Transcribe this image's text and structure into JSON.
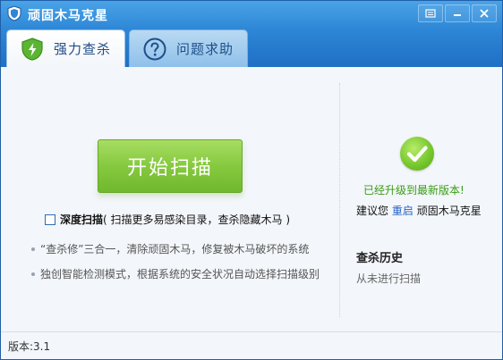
{
  "window": {
    "title": "顽固木马克星",
    "buttons": {
      "menu_icon": "menu-icon",
      "minimize_icon": "minimize-icon",
      "close_icon": "close-icon"
    }
  },
  "tabs": [
    {
      "label": "强力查杀",
      "icon": "shield-lightning-icon",
      "active": true
    },
    {
      "label": "问题求助",
      "icon": "question-icon",
      "active": false
    }
  ],
  "scan": {
    "start_button": "开始扫描",
    "deep_scan_label": "深度扫描",
    "deep_scan_desc": "( 扫描更多易感染目录，查杀隐藏木马 )",
    "deep_scan_checked": false
  },
  "features": [
    "“查杀修”三合一，清除顽固木马，修复被木马破坏的系统",
    "独创智能检测模式，根据系统的安全状况自动选择扫描级别"
  ],
  "status": {
    "upgraded_text": "已经升级到最新版本!",
    "suggest_prefix": "建议您",
    "restart_link": "重启",
    "suggest_suffix": "顽固木马克星"
  },
  "history": {
    "title": "查杀历史",
    "status": "从未进行扫描"
  },
  "footer": {
    "version": "版本:3.1"
  },
  "colors": {
    "accent_blue": "#2d86d6",
    "start_green": "#86c93f",
    "success_green": "#3a9c16",
    "link_blue": "#2563c7"
  }
}
